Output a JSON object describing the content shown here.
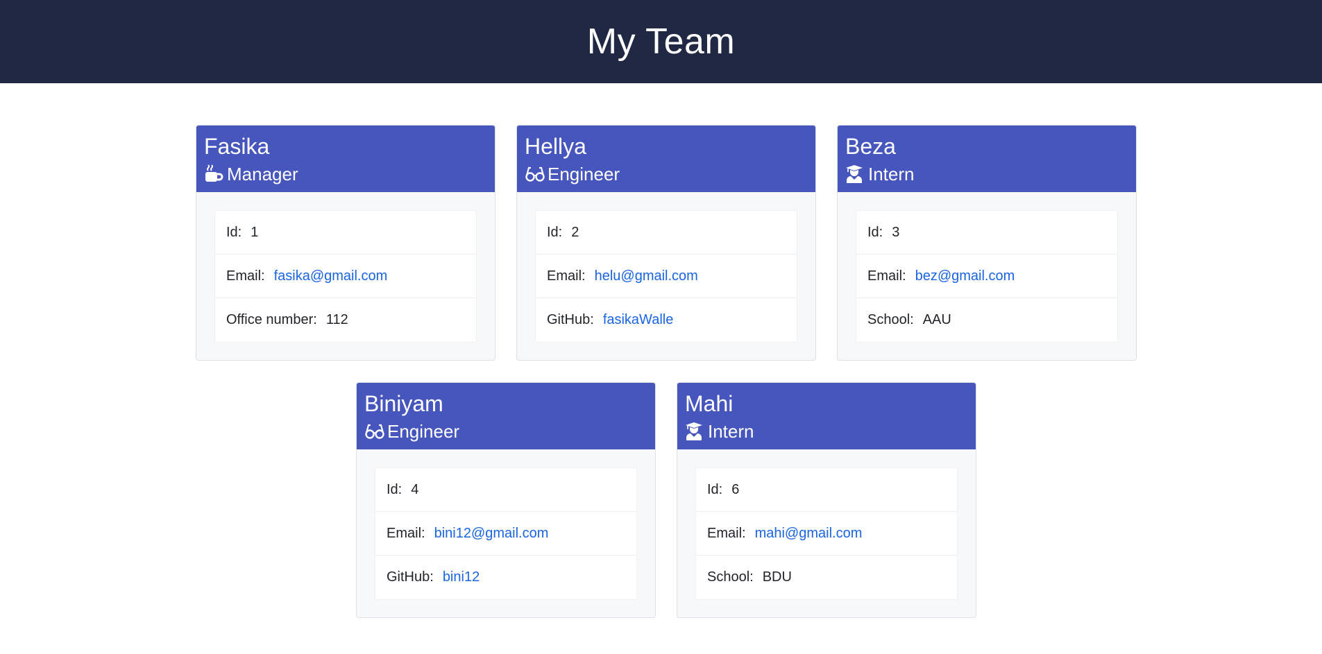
{
  "header": {
    "title": "My Team"
  },
  "cards": [
    {
      "name": "Fasika",
      "role": "Manager",
      "role_icon": "mug-icon",
      "rows": [
        {
          "label": "Id:",
          "value": "1"
        },
        {
          "label": "Email:",
          "value": "fasika@gmail.com"
        },
        {
          "label": "Office number:",
          "value": "112"
        }
      ]
    },
    {
      "name": "Hellya",
      "role": "Engineer",
      "role_icon": "glasses-icon",
      "rows": [
        {
          "label": "Id:",
          "value": "2"
        },
        {
          "label": "Email:",
          "value": "helu@gmail.com"
        },
        {
          "label": "GitHub:",
          "value": "fasikaWalle"
        }
      ]
    },
    {
      "name": "Beza",
      "role": "Intern",
      "role_icon": "graduate-icon",
      "rows": [
        {
          "label": "Id:",
          "value": "3"
        },
        {
          "label": "Email:",
          "value": "bez@gmail.com"
        },
        {
          "label": "School:",
          "value": "AAU"
        }
      ]
    },
    {
      "name": "Biniyam",
      "role": "Engineer",
      "role_icon": "glasses-icon",
      "rows": [
        {
          "label": "Id:",
          "value": "4"
        },
        {
          "label": "Email:",
          "value": "bini12@gmail.com"
        },
        {
          "label": "GitHub:",
          "value": "bini12"
        }
      ]
    },
    {
      "name": "Mahi",
      "role": "Intern",
      "role_icon": "graduate-icon",
      "rows": [
        {
          "label": "Id:",
          "value": "6"
        },
        {
          "label": "Email:",
          "value": "mahi@gmail.com"
        },
        {
          "label": "School:",
          "value": "BDU"
        }
      ]
    }
  ],
  "colors": {
    "header_bg": "#212844",
    "card_header_bg": "#4656bc",
    "link": "#1a64e6"
  }
}
